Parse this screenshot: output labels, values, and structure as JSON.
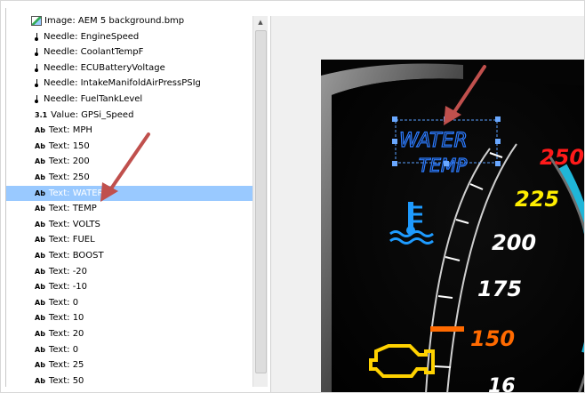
{
  "tree": {
    "items": [
      {
        "type": "image",
        "icon": "image-icon",
        "label": "Image: AEM 5 background.bmp"
      },
      {
        "type": "needle",
        "icon": "needle-icon",
        "label": "Needle: EngineSpeed"
      },
      {
        "type": "needle",
        "icon": "needle-icon",
        "label": "Needle: CoolantTempF"
      },
      {
        "type": "needle",
        "icon": "needle-icon",
        "label": "Needle: ECUBatteryVoltage"
      },
      {
        "type": "needle",
        "icon": "needle-icon",
        "label": "Needle: IntakeManifoldAirPressPSIg"
      },
      {
        "type": "needle",
        "icon": "needle-icon",
        "label": "Needle: FuelTankLevel"
      },
      {
        "type": "value",
        "icon_text": "3.1",
        "label": "Value: GPSi_Speed"
      },
      {
        "type": "text",
        "icon_text": "Ab",
        "label": "Text: MPH"
      },
      {
        "type": "text",
        "icon_text": "Ab",
        "label": "Text: 150"
      },
      {
        "type": "text",
        "icon_text": "Ab",
        "label": "Text: 200"
      },
      {
        "type": "text",
        "icon_text": "Ab",
        "label": "Text: 250"
      },
      {
        "type": "text",
        "icon_text": "Ab",
        "label": "Text: WATER",
        "selected": true
      },
      {
        "type": "text",
        "icon_text": "Ab",
        "label": "Text: TEMP"
      },
      {
        "type": "text",
        "icon_text": "Ab",
        "label": "Text: VOLTS"
      },
      {
        "type": "text",
        "icon_text": "Ab",
        "label": "Text: FUEL"
      },
      {
        "type": "text",
        "icon_text": "Ab",
        "label": "Text: BOOST"
      },
      {
        "type": "text",
        "icon_text": "Ab",
        "label": "Text: -20"
      },
      {
        "type": "text",
        "icon_text": "Ab",
        "label": "Text: -10"
      },
      {
        "type": "text",
        "icon_text": "Ab",
        "label": "Text: 0"
      },
      {
        "type": "text",
        "icon_text": "Ab",
        "label": "Text: 10"
      },
      {
        "type": "text",
        "icon_text": "Ab",
        "label": "Text: 20"
      },
      {
        "type": "text",
        "icon_text": "Ab",
        "label": "Text: 0"
      },
      {
        "type": "text",
        "icon_text": "Ab",
        "label": "Text: 25"
      },
      {
        "type": "text",
        "icon_text": "Ab",
        "label": "Text: 50"
      }
    ]
  },
  "gauge": {
    "selected_text_lines": [
      "WATER",
      "TEMP"
    ],
    "scale_labels": [
      "250",
      "225",
      "200",
      "175",
      "150",
      "16"
    ],
    "scale_label_colors": [
      "#ff1a1a",
      "#ffee00",
      "#ffffff",
      "#ffffff",
      "#ff6a00",
      "#ffffff"
    ],
    "water_text_color": "#2c7bff",
    "coolant_icon_color": "#1e9bff",
    "engine_icon_color": "#ffd200",
    "accent_teal": "#1fb6d8",
    "annotation_arrow_color": "#c0504d"
  },
  "colors": {
    "selection": "#99c9ff"
  }
}
